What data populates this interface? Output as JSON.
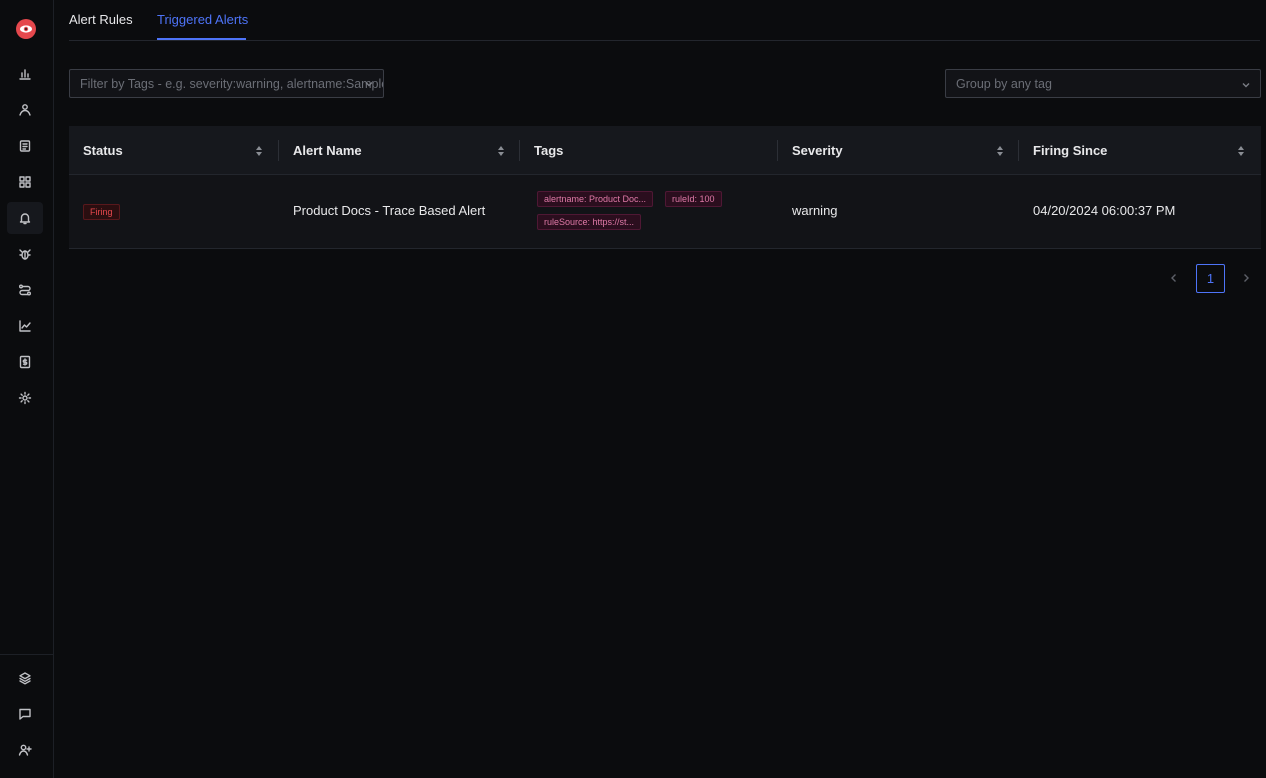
{
  "sidebar": {
    "logo": "signoz-eye-logo",
    "items": [
      {
        "icon": "bar-chart-icon",
        "active": false
      },
      {
        "icon": "user-path-icon",
        "active": false
      },
      {
        "icon": "logs-icon",
        "active": false
      },
      {
        "icon": "dashboard-grid-icon",
        "active": false
      },
      {
        "icon": "bell-alert-icon",
        "active": true
      },
      {
        "icon": "bug-icon",
        "active": false
      },
      {
        "icon": "route-icon",
        "active": false
      },
      {
        "icon": "line-chart-icon",
        "active": false
      },
      {
        "icon": "billing-icon",
        "active": false
      },
      {
        "icon": "gear-icon",
        "active": false
      }
    ],
    "bottom_items": [
      {
        "icon": "layers-icon"
      },
      {
        "icon": "message-icon"
      },
      {
        "icon": "invite-user-icon"
      }
    ]
  },
  "tabs": [
    {
      "label": "Alert Rules",
      "active": false
    },
    {
      "label": "Triggered Alerts",
      "active": true
    }
  ],
  "filter": {
    "placeholder": "Filter by Tags - e.g. severity:warning, alertname:Sample..."
  },
  "groupby": {
    "placeholder": "Group by any tag"
  },
  "table": {
    "columns": [
      "Status",
      "Alert Name",
      "Tags",
      "Severity",
      "Firing Since"
    ],
    "rows": [
      {
        "status": "Firing",
        "alert_name": "Product Docs - Trace Based Alert",
        "tags": [
          "alertname: Product Doc...",
          "ruleId: 100",
          "ruleSource: https://st..."
        ],
        "severity": "warning",
        "firing_since": "04/20/2024 06:00:37 PM"
      }
    ]
  },
  "pagination": {
    "current_page": "1"
  },
  "colors": {
    "accent": "#4e74f8",
    "firing": "#e5484d",
    "tag": "#e07aa8"
  }
}
